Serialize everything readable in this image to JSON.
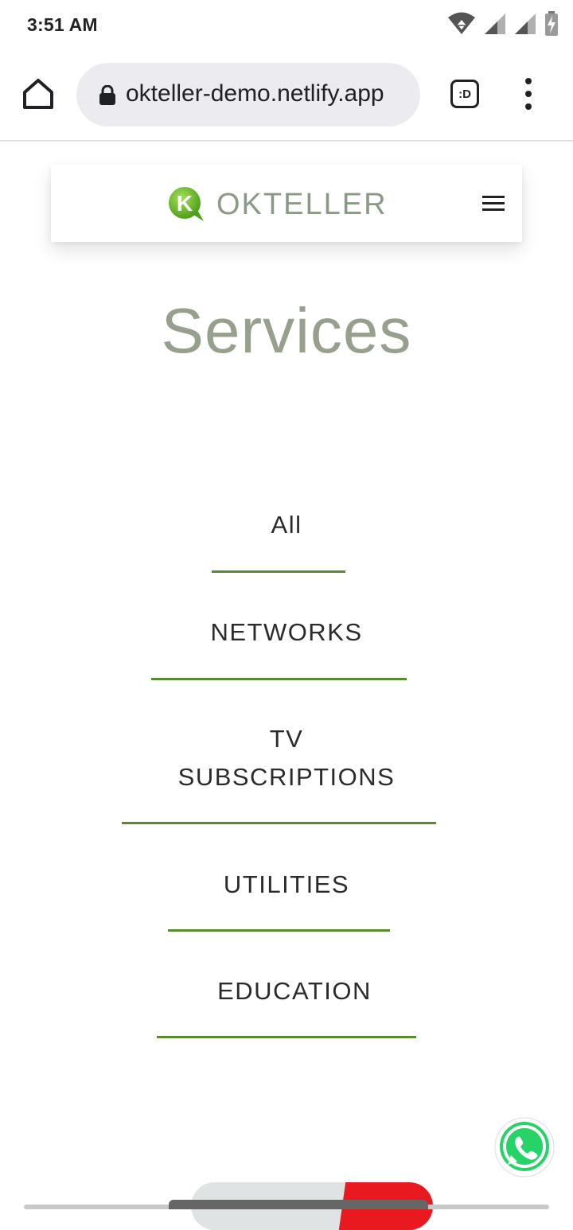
{
  "status_bar": {
    "time": "3:51 AM",
    "icons": [
      "wifi-icon",
      "signal-icon",
      "signal-icon",
      "battery-charging-icon"
    ]
  },
  "browser": {
    "url": "okteller-demo.netlify.app",
    "icons": [
      "home-icon",
      "lock-icon",
      "tab-switcher-icon",
      "overflow-menu-icon"
    ],
    "tab_label": ":D"
  },
  "site": {
    "brand_name": "OKTELLER",
    "logo_letter": "K",
    "icons": [
      "okteller-logo-icon",
      "hamburger-menu-icon"
    ],
    "brand_color": "#8b9a84",
    "logo_color": "#6ab82b"
  },
  "page": {
    "title": "Services",
    "title_color": "#96a08d"
  },
  "services": {
    "tabs": [
      {
        "label": "All"
      },
      {
        "label": "NETWORKS"
      },
      {
        "label": "TV SUBSCRIPTIONS"
      },
      {
        "label": "UTILITIES"
      },
      {
        "label": "EDUCATION"
      }
    ],
    "underline_color": "#5a8a2e"
  },
  "floating": {
    "icons": [
      "whatsapp-icon"
    ],
    "whatsapp_color": "#25d366"
  }
}
